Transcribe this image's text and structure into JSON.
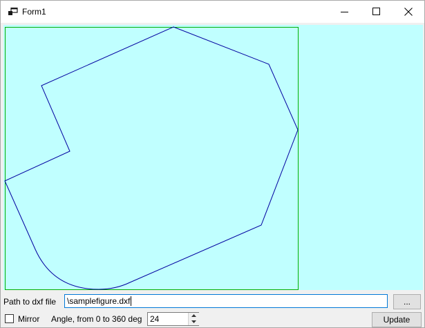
{
  "window": {
    "title": "Form1",
    "app_icon": "windows-forms-icon",
    "controls": [
      "minimize-icon",
      "maximize-icon",
      "close-icon"
    ]
  },
  "canvas": {
    "background": "#c0ffff",
    "bounding_box_color": "#00b000",
    "figure_color": "#0000a0"
  },
  "path": {
    "label": "Path to dxf file",
    "value": "\\samplefigure.dxf",
    "browse_label": "..."
  },
  "options": {
    "mirror_label": "Mirror",
    "mirror_checked": false,
    "angle_label": "Angle, from 0 to 360 deg",
    "angle_value": "24",
    "update_label": "Update"
  },
  "colors": {
    "focus_border": "#0078d7",
    "button_face": "#e1e1e1",
    "form_background": "#f0f0f0"
  }
}
